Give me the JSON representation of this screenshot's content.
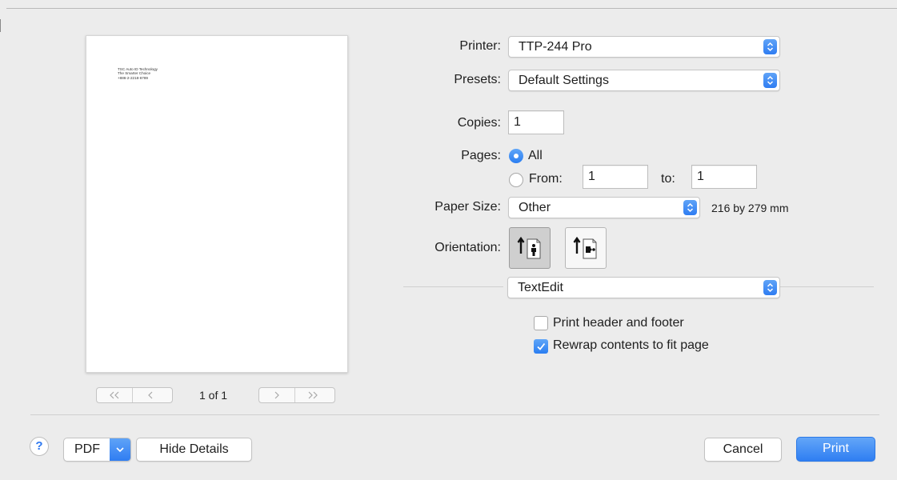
{
  "preview": {
    "letterhead_lines": [
      "TSC Auto ID Technology",
      "The Smarter Choice",
      "+886-2-2218-6789"
    ],
    "first_page_icon": "double-chevron-left-icon",
    "prev_page_icon": "chevron-left-icon",
    "next_page_icon": "chevron-right-icon",
    "last_page_icon": "double-chevron-right-icon",
    "page_count": "1 of 1"
  },
  "settings": {
    "printer": {
      "label": "Printer:",
      "value": "TTP-244 Pro"
    },
    "presets": {
      "label": "Presets:",
      "value": "Default Settings"
    },
    "copies": {
      "label": "Copies:",
      "value": "1"
    },
    "pages": {
      "label": "Pages:",
      "all_label": "All",
      "all_selected": true,
      "from_label": "From:",
      "from_value": "1",
      "to_label": "to:",
      "to_value": "1"
    },
    "paper_size": {
      "label": "Paper Size:",
      "value": "Other",
      "dimensions": "216 by 279 mm"
    },
    "orientation": {
      "label": "Orientation:",
      "selected": "portrait"
    },
    "app_panel": {
      "value": "TextEdit"
    },
    "print_header_footer": {
      "label": "Print header and footer",
      "checked": false
    },
    "rewrap_contents": {
      "label": "Rewrap contents to fit page",
      "checked": true
    }
  },
  "footer": {
    "help_label": "?",
    "pdf_label": "PDF",
    "hide_details_label": "Hide Details",
    "cancel_label": "Cancel",
    "print_label": "Print"
  },
  "colors": {
    "accent": "#2f7ef2",
    "background": "#ececec"
  }
}
